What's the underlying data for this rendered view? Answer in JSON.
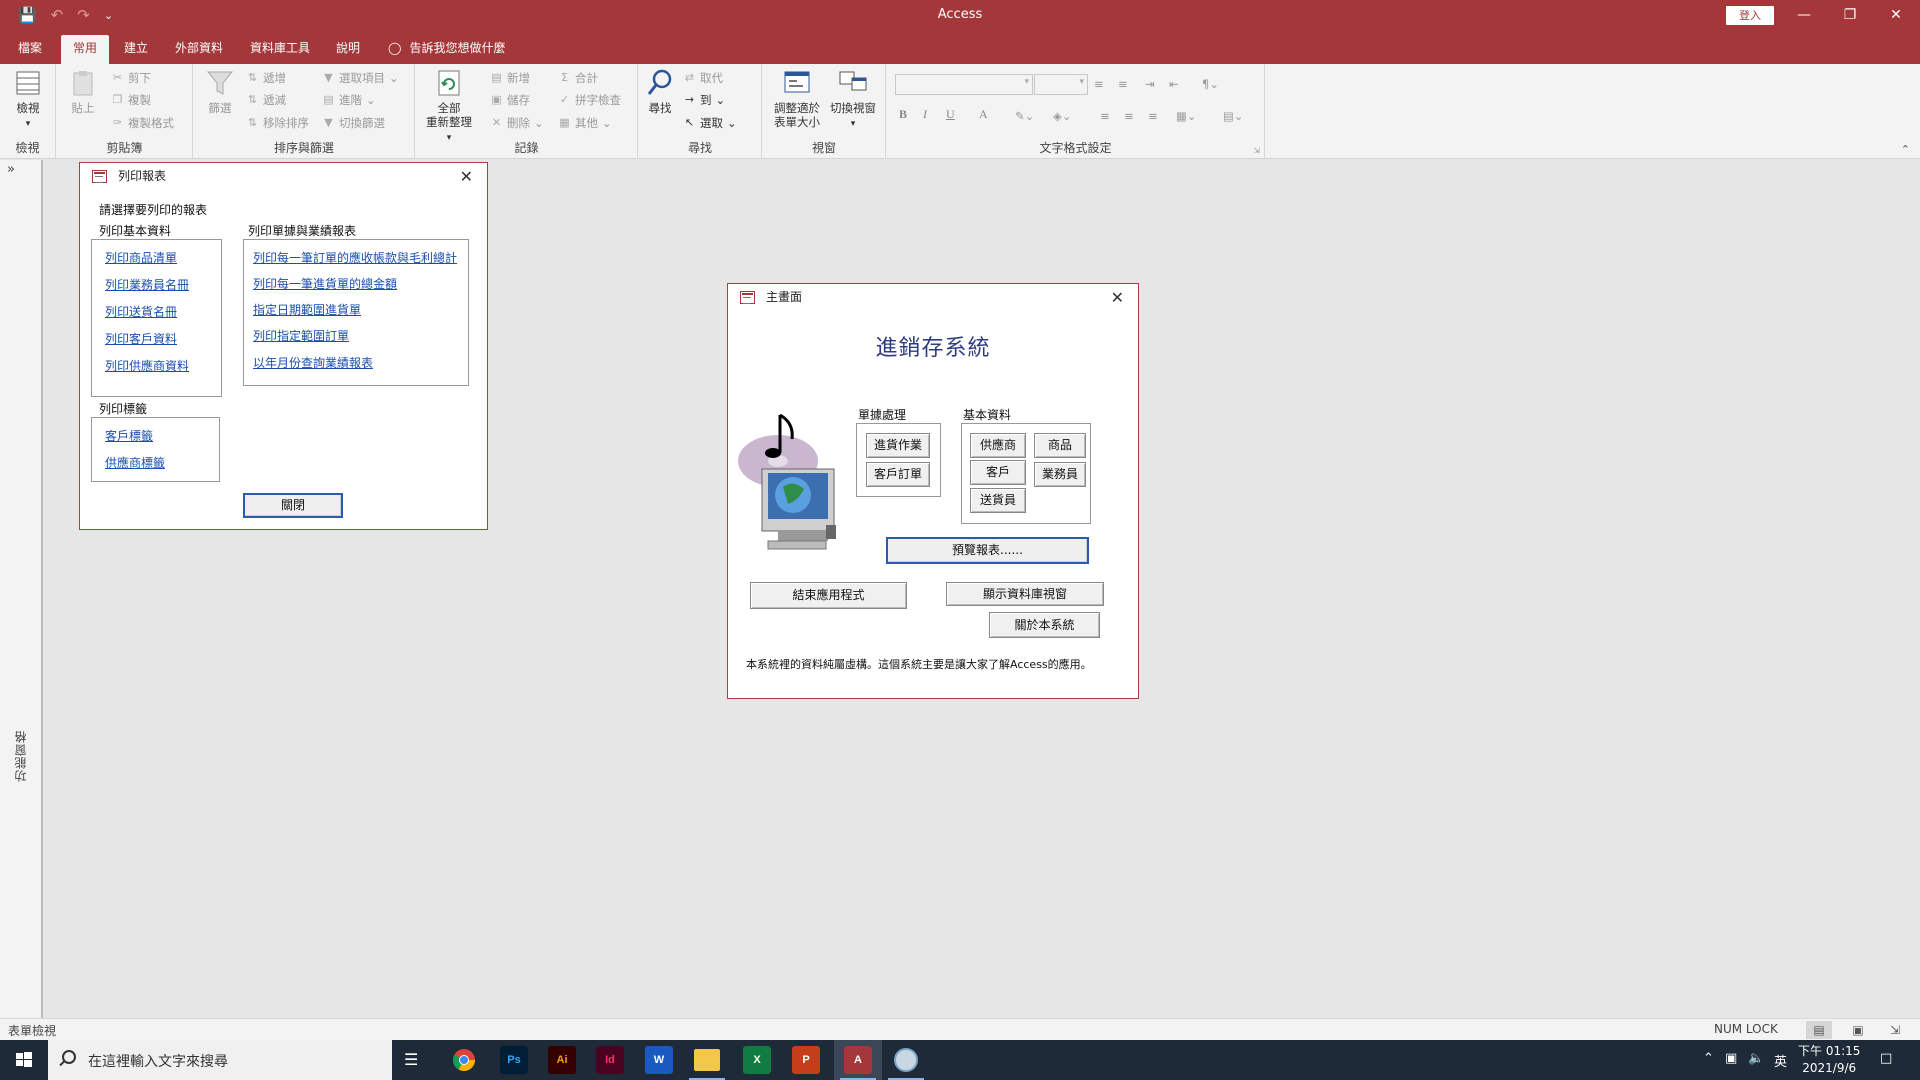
{
  "app": {
    "title": "Access",
    "signin": "登入"
  },
  "tabs": [
    "檔案",
    "常用",
    "建立",
    "外部資料",
    "資料庫工具",
    "說明"
  ],
  "active_tab": "常用",
  "tellme": "告訴我您想做什麼",
  "ribbon": {
    "view": {
      "button": "檢視",
      "group": "檢視"
    },
    "clipboard": {
      "paste": "貼上",
      "cut": "剪下",
      "copy": "複製",
      "format_painter": "複製格式",
      "group": "剪貼簿"
    },
    "sort_filter": {
      "filter": "篩選",
      "ascending": "遞增",
      "descending": "遞減",
      "remove_sort": "移除排序",
      "selection": "選取項目",
      "advanced": "進階",
      "toggle_filter": "切換篩選",
      "group": "排序與篩選"
    },
    "records": {
      "refresh_all_1": "全部",
      "refresh_all_2": "重新整理",
      "new": "新增",
      "save": "儲存",
      "delete": "刪除",
      "totals": "合計",
      "spelling": "拼字檢查",
      "more": "其他",
      "group": "記錄"
    },
    "find": {
      "find": "尋找",
      "replace": "取代",
      "goto": "到",
      "select": "選取",
      "group": "尋找"
    },
    "window": {
      "size_to_fit_1": "調整適於",
      "size_to_fit_2": "表單大小",
      "switch_windows": "切換視窗",
      "group": "視窗"
    },
    "text_format": {
      "bold": "B",
      "italic": "I",
      "underline": "U",
      "font_color": "A",
      "group": "文字格式設定"
    }
  },
  "nav_pane": {
    "label": "功能窗格"
  },
  "print_form": {
    "title": "列印報表",
    "prompt": "請選擇要列印的報表",
    "basic_header": "列印基本資料",
    "basic_links": [
      "列印商品清單",
      "列印業務員名冊",
      "列印送貨名冊",
      "列印客戶資料",
      "列印供應商資料"
    ],
    "doc_header": "列印單據與業績報表",
    "doc_links": [
      "列印每一筆訂單的應收帳款與毛利總計",
      "列印每一筆進貨單的總金額",
      "指定日期範圍進貨單",
      "列印指定範圍訂單",
      "以年月份查詢業績報表"
    ],
    "label_header": "列印標籤",
    "label_links": [
      "客戶標籤",
      "供應商標籤"
    ],
    "close_button": "關閉"
  },
  "main_form": {
    "title": "主畫面",
    "heading": "進銷存系統",
    "docs_header": "單據處理",
    "docs_buttons": [
      "進貨作業",
      "客戶訂單"
    ],
    "basic_header": "基本資料",
    "basic_buttons": [
      "供應商",
      "商品",
      "客戶",
      "業務員",
      "送貨員"
    ],
    "preview_button": "預覽報表......",
    "exit_button": "結束應用程式",
    "show_db_button": "顯示資料庫視窗",
    "about_button": "關於本系統",
    "footer": "本系統裡的資料純屬虛構。這個系統主要是讓大家了解Access的應用。"
  },
  "status": {
    "left": "表單檢視",
    "numlock": "NUM LOCK"
  },
  "taskbar": {
    "search_placeholder": "在這裡輸入文字來搜尋",
    "apps": [
      {
        "name": "Ps",
        "color": "#001e36",
        "fg": "#31a8ff"
      },
      {
        "name": "Ai",
        "color": "#330000",
        "fg": "#ff9a00"
      },
      {
        "name": "Id",
        "color": "#49021f",
        "fg": "#ff3366"
      },
      {
        "name": "W",
        "color": "#185abd",
        "fg": "#ffffff"
      },
      {
        "name": "X",
        "color": "#107c41",
        "fg": "#ffffff"
      },
      {
        "name": "P",
        "color": "#c43e1c",
        "fg": "#ffffff"
      },
      {
        "name": "A",
        "color": "#a4373a",
        "fg": "#ffffff"
      }
    ],
    "ime": "英",
    "time": "下午 01:15",
    "date": "2021/9/6"
  }
}
